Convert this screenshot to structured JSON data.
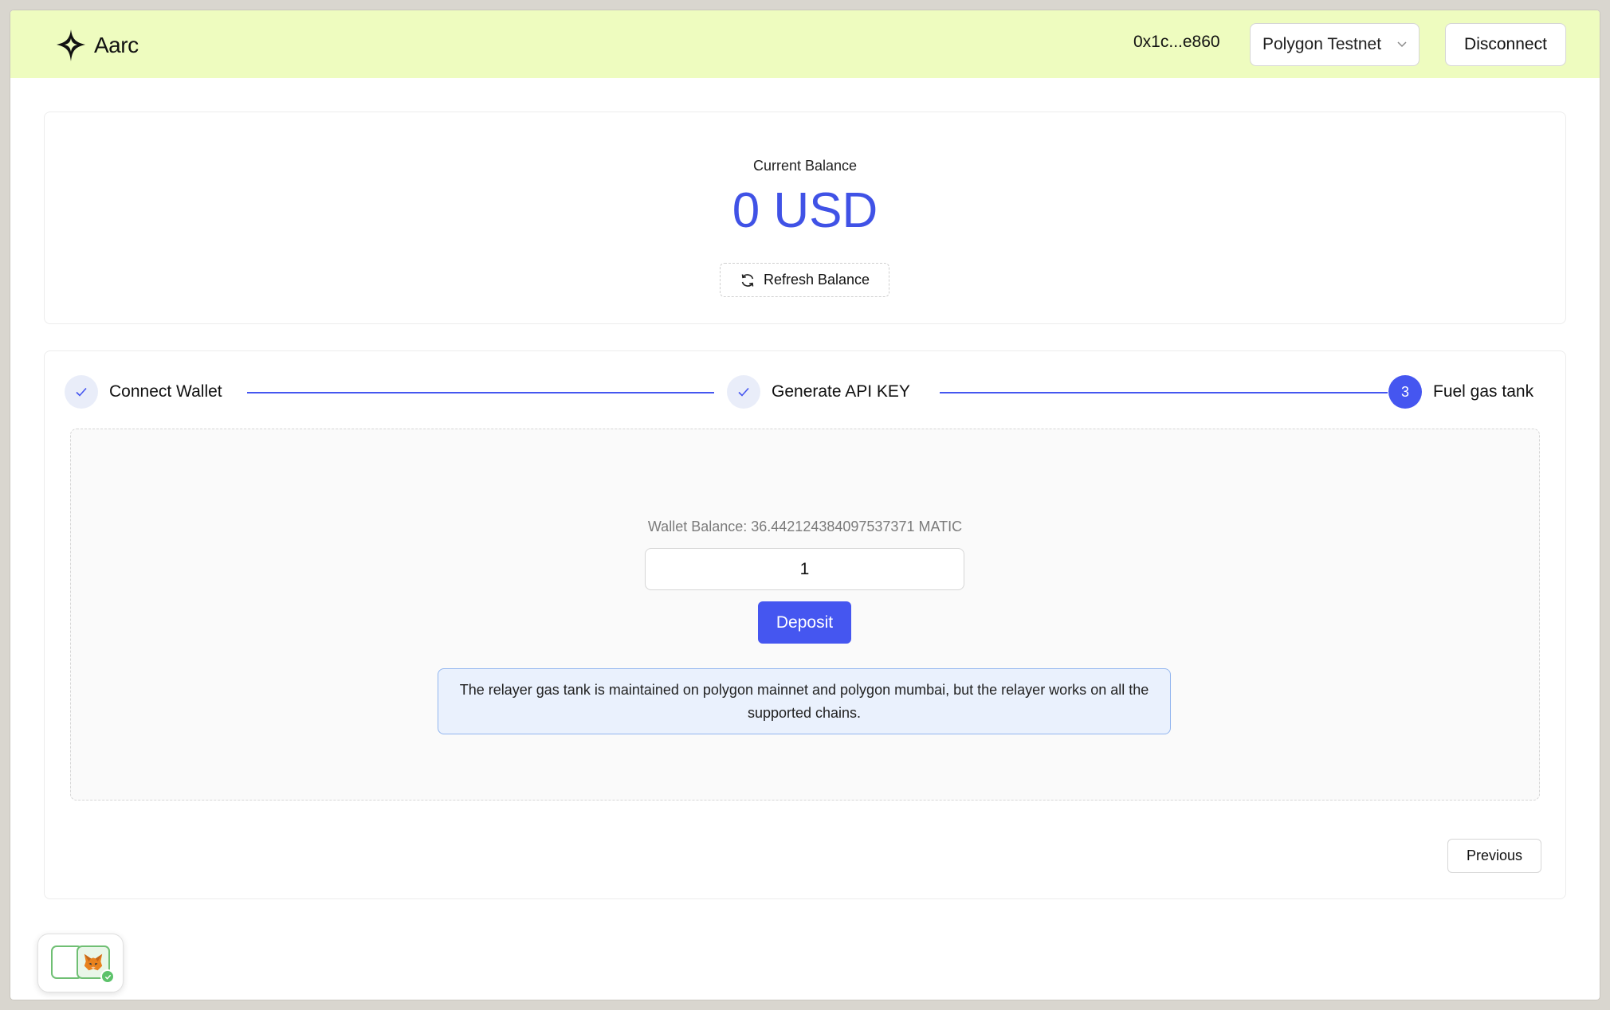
{
  "header": {
    "brand": "Aarc",
    "address": "0x1c...e860",
    "network": "Polygon Testnet",
    "disconnect_label": "Disconnect"
  },
  "balance": {
    "label": "Current Balance",
    "value": "0 USD",
    "refresh_label": "Refresh Balance"
  },
  "steps": [
    {
      "label": "Connect Wallet",
      "status": "done"
    },
    {
      "label": "Generate API KEY",
      "status": "done"
    },
    {
      "number": "3",
      "label": "Fuel gas tank",
      "status": "active"
    }
  ],
  "fuel": {
    "wallet_balance": "Wallet Balance: 36.442124384097537371 MATIC",
    "amount_value": "1",
    "deposit_label": "Deposit",
    "info_text": "The relayer gas tank is maintained on polygon mainnet and polygon mumbai, but the relayer works on all the supported chains."
  },
  "nav": {
    "previous_label": "Previous"
  },
  "colors": {
    "header_bg": "#eefcbf",
    "accent": "#4556f0",
    "balance_text": "#4052e6",
    "info_bg": "#eaf1fd",
    "info_border": "#93b6ef"
  },
  "icons": {
    "logo": "sparkle-star-icon",
    "network_caret": "chevron-down-icon",
    "refresh": "refresh-icon",
    "step_done": "check-icon",
    "extension": "metamask-fox-icon"
  }
}
